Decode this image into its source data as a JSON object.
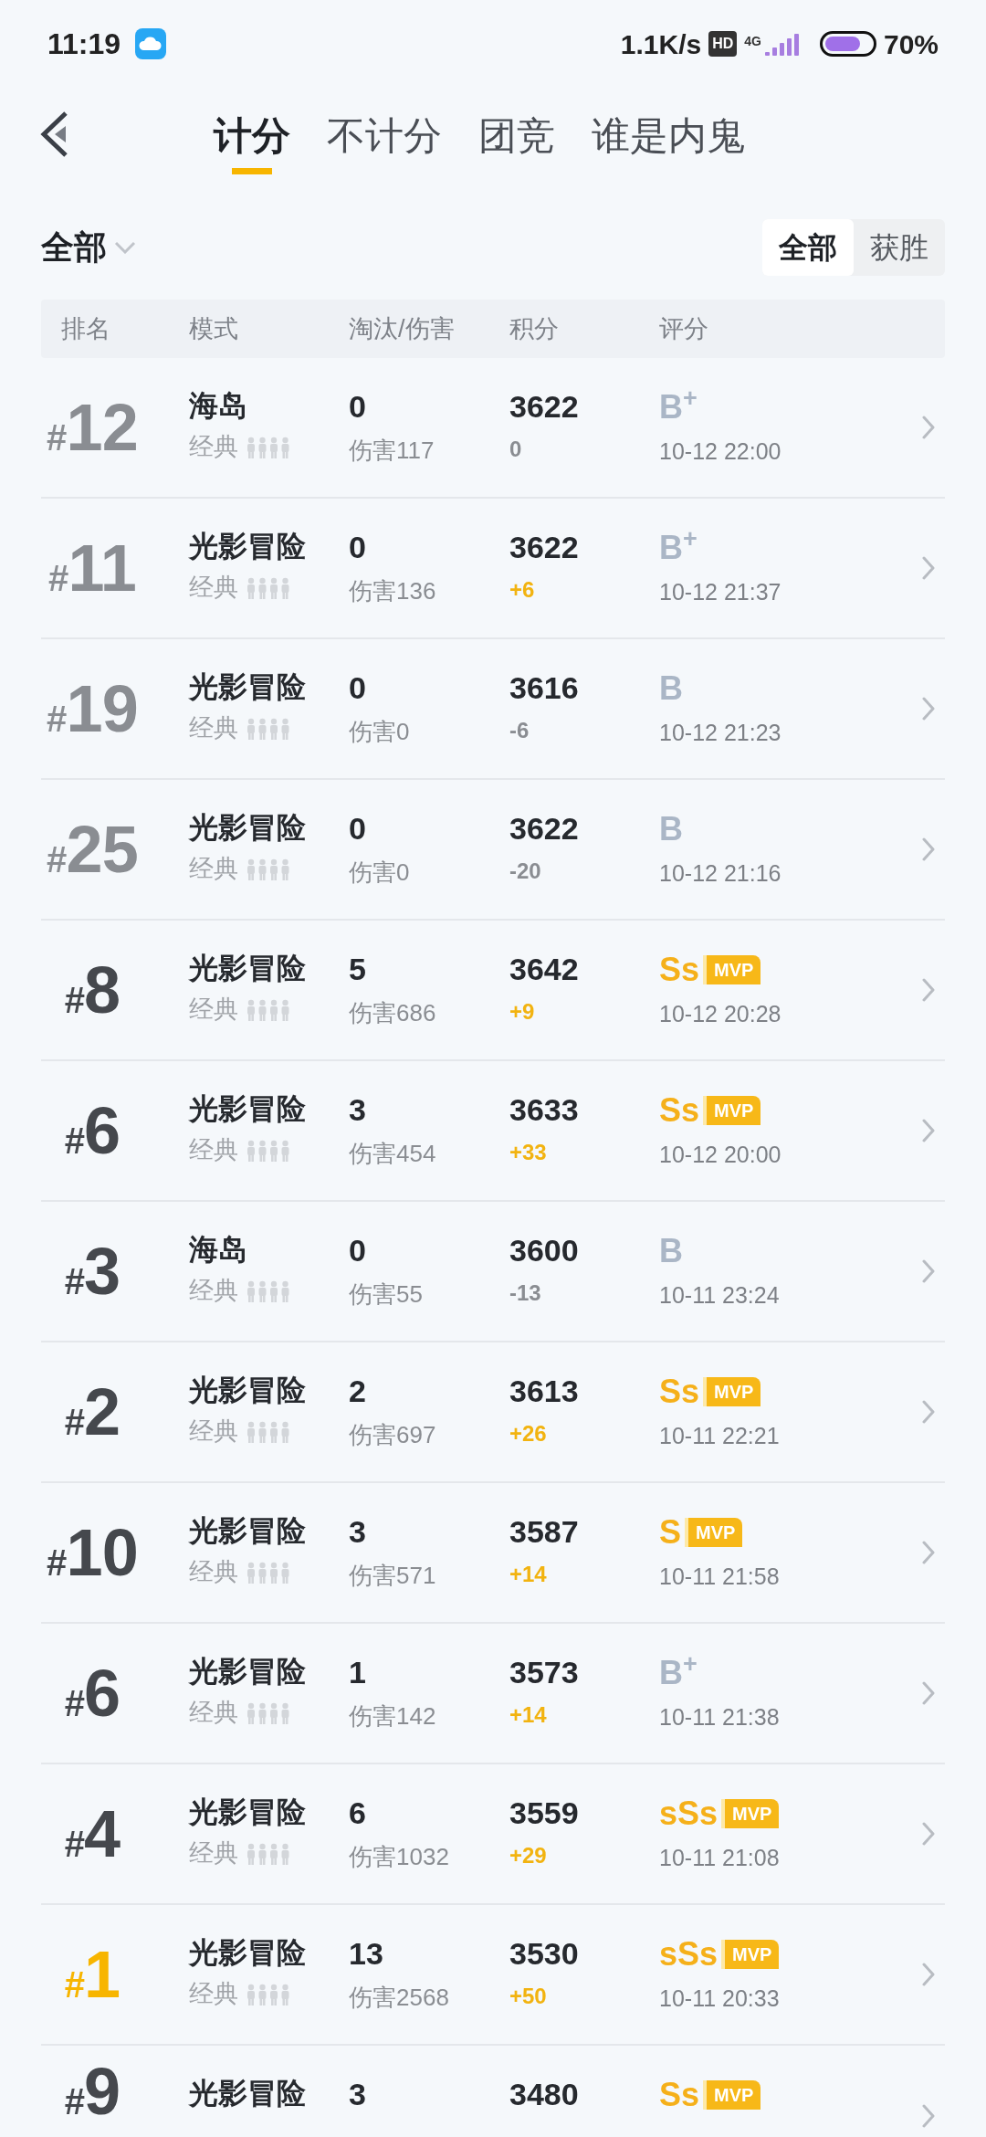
{
  "status_bar": {
    "time": "11:19",
    "speed": "1.1K/s",
    "hd": "HD",
    "network": "4G",
    "battery": "70%"
  },
  "tabs": [
    {
      "label": "计分",
      "selected": true
    },
    {
      "label": "不计分",
      "selected": false
    },
    {
      "label": "团竞",
      "selected": false
    },
    {
      "label": "谁是内鬼",
      "selected": false
    }
  ],
  "filter": {
    "label": "全部"
  },
  "segments": [
    {
      "label": "全部",
      "selected": true
    },
    {
      "label": "获胜",
      "selected": false
    }
  ],
  "columns": [
    "排名",
    "模式",
    "淘汰/伤害",
    "积分",
    "评分"
  ],
  "rows": [
    {
      "rank": "#12",
      "dimmed": true,
      "highlighted": false,
      "mode": "海岛",
      "sub": "经典",
      "kills": "0",
      "damage": "伤害117",
      "score": "3622",
      "delta": "0",
      "gain": false,
      "grade": "B$^{+}$",
      "grade_gold": false,
      "mvp": false,
      "time": "10-12 22:00"
    },
    {
      "rank": "#11",
      "dimmed": true,
      "highlighted": false,
      "mode": "光影冒险",
      "sub": "经典",
      "kills": "0",
      "damage": "伤害136",
      "score": "3622",
      "delta": "+6",
      "gain": true,
      "grade": "B$^{+}$",
      "grade_gold": false,
      "mvp": false,
      "time": "10-12 21:37"
    },
    {
      "rank": "#19",
      "dimmed": true,
      "highlighted": false,
      "mode": "光影冒险",
      "sub": "经典",
      "kills": "0",
      "damage": "伤害0",
      "score": "3616",
      "delta": "-6",
      "gain": false,
      "grade": "B",
      "grade_gold": false,
      "mvp": false,
      "time": "10-12 21:23"
    },
    {
      "rank": "#25",
      "dimmed": true,
      "highlighted": false,
      "mode": "光影冒险",
      "sub": "经典",
      "kills": "0",
      "damage": "伤害0",
      "score": "3622",
      "delta": "-20",
      "gain": false,
      "grade": "B",
      "grade_gold": false,
      "mvp": false,
      "time": "10-12 21:16"
    },
    {
      "rank": "#8",
      "dimmed": false,
      "highlighted": false,
      "mode": "光影冒险",
      "sub": "经典",
      "kills": "5",
      "damage": "伤害686",
      "score": "3642",
      "delta": "+9",
      "gain": true,
      "grade": "Ss",
      "grade_gold": true,
      "mvp": true,
      "mvp_label": "MVP",
      "time": "10-12 20:28"
    },
    {
      "rank": "#6",
      "dimmed": false,
      "highlighted": false,
      "mode": "光影冒险",
      "sub": "经典",
      "kills": "3",
      "damage": "伤害454",
      "score": "3633",
      "delta": "+33",
      "gain": true,
      "grade": "Ss",
      "grade_gold": true,
      "mvp": true,
      "mvp_label": "MVP",
      "time": "10-12 20:00"
    },
    {
      "rank": "#3",
      "dimmed": false,
      "highlighted": false,
      "mode": "海岛",
      "sub": "经典",
      "kills": "0",
      "damage": "伤害55",
      "score": "3600",
      "delta": "-13",
      "gain": false,
      "grade": "B",
      "grade_gold": false,
      "mvp": false,
      "time": "10-11 23:24"
    },
    {
      "rank": "#2",
      "dimmed": false,
      "highlighted": false,
      "mode": "光影冒险",
      "sub": "经典",
      "kills": "2",
      "damage": "伤害697",
      "score": "3613",
      "delta": "+26",
      "gain": true,
      "grade": "Ss",
      "grade_gold": true,
      "mvp": true,
      "mvp_label": "MVP",
      "time": "10-11 22:21"
    },
    {
      "rank": "#10",
      "dimmed": false,
      "highlighted": false,
      "mode": "光影冒险",
      "sub": "经典",
      "kills": "3",
      "damage": "伤害571",
      "score": "3587",
      "delta": "+14",
      "gain": true,
      "grade": "S",
      "grade_gold": true,
      "mvp": true,
      "mvp_label": "MVP",
      "time": "10-11 21:58"
    },
    {
      "rank": "#6",
      "dimmed": false,
      "highlighted": false,
      "mode": "光影冒险",
      "sub": "经典",
      "kills": "1",
      "damage": "伤害142",
      "score": "3573",
      "delta": "+14",
      "gain": true,
      "grade": "B$^{+}$",
      "grade_gold": false,
      "mvp": false,
      "time": "10-11 21:38"
    },
    {
      "rank": "#4",
      "dimmed": false,
      "highlighted": false,
      "mode": "光影冒险",
      "sub": "经典",
      "kills": "6",
      "damage": "伤害1032",
      "score": "3559",
      "delta": "+29",
      "gain": true,
      "grade": "sSs",
      "grade_gold": true,
      "mvp": true,
      "mvp_label": "MVP",
      "time": "10-11 21:08"
    },
    {
      "rank": "#1",
      "dimmed": false,
      "highlighted": true,
      "mode": "光影冒险",
      "sub": "经典",
      "kills": "13",
      "damage": "伤害2568",
      "score": "3530",
      "delta": "+50",
      "gain": true,
      "grade": "sSs",
      "grade_gold": true,
      "mvp": true,
      "mvp_label": "MVP",
      "time": "10-11 20:33"
    },
    {
      "rank": "#9",
      "dimmed": false,
      "highlighted": false,
      "mode": "光影冒险",
      "kills": "3",
      "score": "3480",
      "grade": "Ss",
      "grade_gold": true,
      "mvp": true,
      "mvp_label": "MVP"
    }
  ]
}
